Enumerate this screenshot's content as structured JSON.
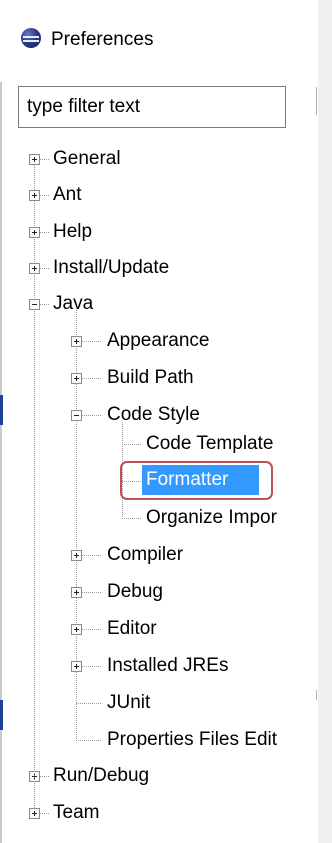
{
  "window": {
    "title": "Preferences",
    "icon": "eclipse-icon"
  },
  "filter": {
    "placeholder": "type filter text"
  },
  "tree": {
    "general": "General",
    "ant": "Ant",
    "help": "Help",
    "install_update": "Install/Update",
    "java": "Java",
    "appearance": "Appearance",
    "build_path": "Build Path",
    "code_style": "Code Style",
    "code_template": "Code Template",
    "formatter": "Formatter",
    "organize_imports": "Organize Impor",
    "compiler": "Compiler",
    "debug": "Debug",
    "editor": "Editor",
    "installed_jres": "Installed JREs",
    "junit": "JUnit",
    "properties_files_editor": "Properties Files Edit",
    "run_debug": "Run/Debug",
    "team": "Team"
  },
  "colors": {
    "selection": "#3399ff",
    "highlight_border": "#c0504d"
  }
}
